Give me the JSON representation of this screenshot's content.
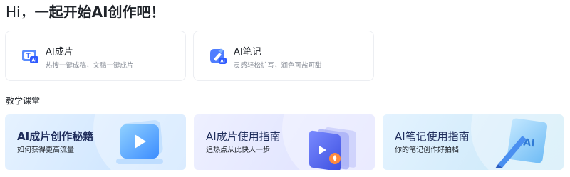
{
  "greeting": {
    "hi": "Hi，",
    "text": "一起开始AI创作吧！"
  },
  "tools": [
    {
      "title": "AI成片",
      "desc": "热搜一键成稿，文稿一键成片",
      "icon": "ai-video-icon"
    },
    {
      "title": "AI笔记",
      "desc": "灵感轻松扩写，润色可盐可甜",
      "icon": "ai-note-icon"
    }
  ],
  "section": {
    "title": "教学课堂"
  },
  "courses": [
    {
      "title": "AI成片创作秘籍",
      "subtitle": "如何获得更高流量",
      "illustration": "play-video-illustration"
    },
    {
      "title": "AI成片使用指南",
      "subtitle": "追热点从此快人一步",
      "illustration": "video-stack-illustration"
    },
    {
      "title": "AI笔记使用指南",
      "subtitle": "你的笔记创作好拍档",
      "illustration": "ai-pen-illustration"
    }
  ],
  "colors": {
    "accent": "#3b6cff",
    "card_border": "#eceef2",
    "title_dark": "#1f2d5c"
  }
}
